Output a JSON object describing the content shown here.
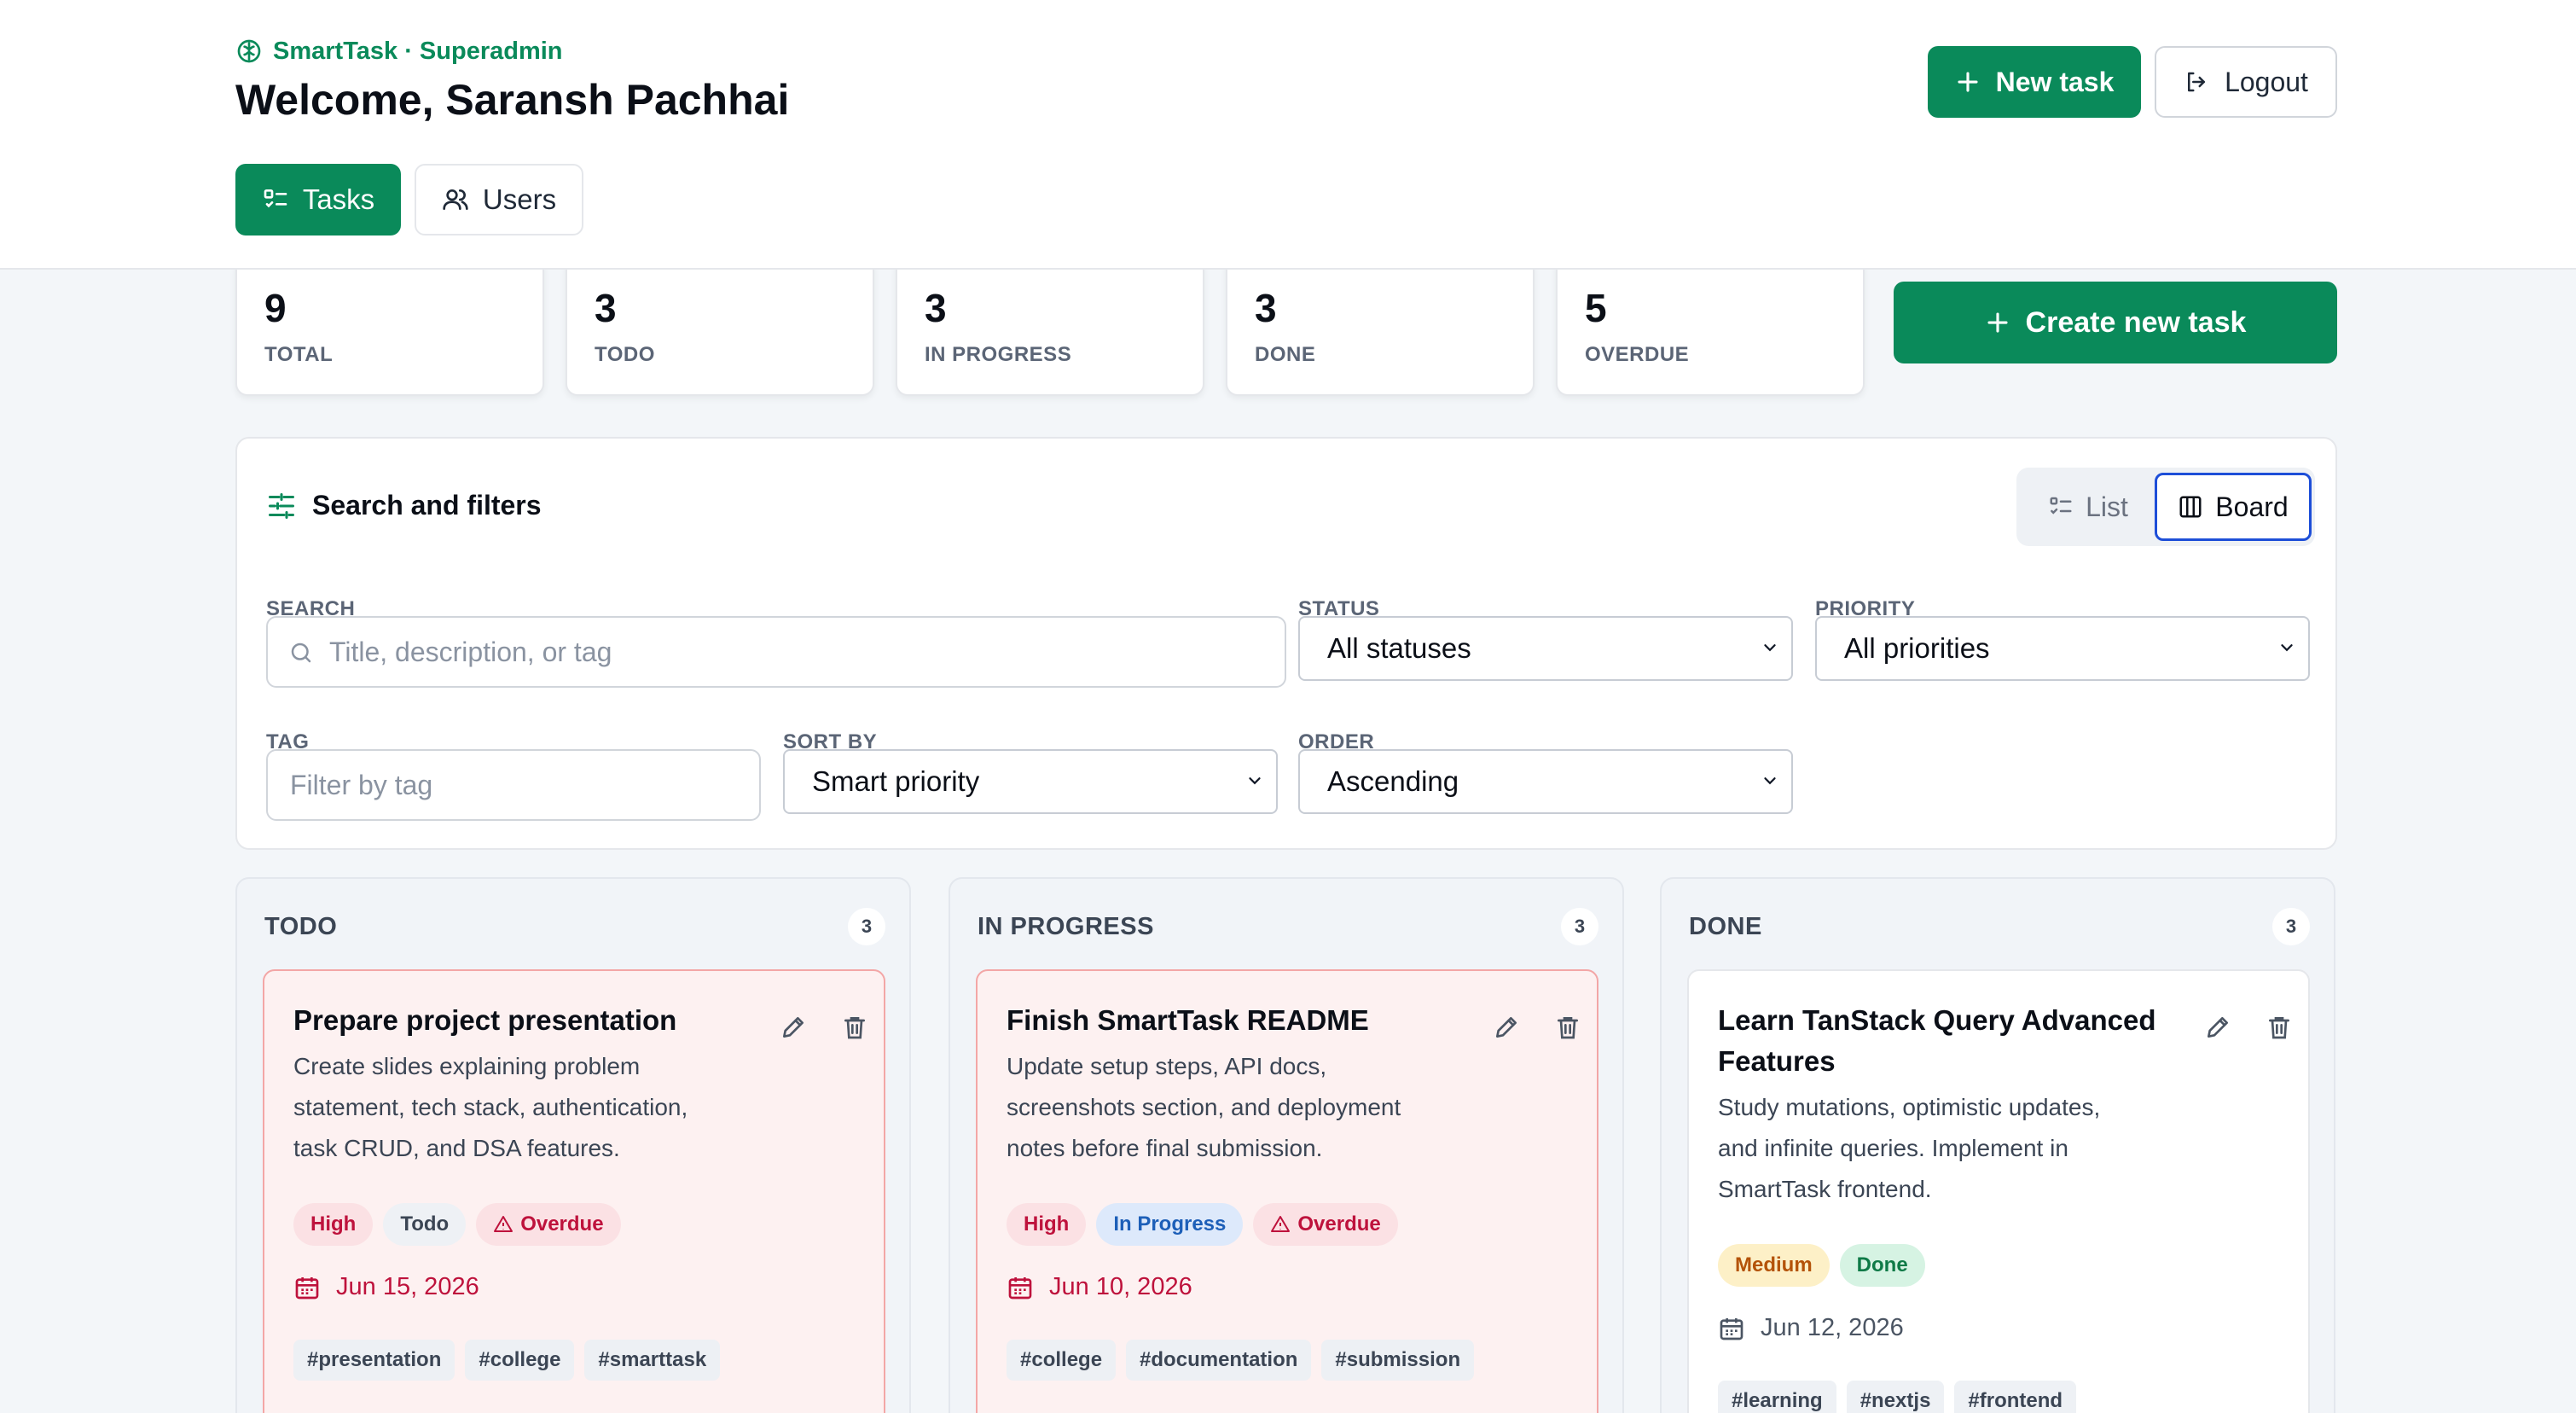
{
  "header": {
    "brand": "SmartTask · Superadmin",
    "welcome": "Welcome, Saransh Pachhai",
    "new_task_label": "New task",
    "logout_label": "Logout"
  },
  "nav": {
    "tabs": [
      {
        "label": "Tasks",
        "active": true
      },
      {
        "label": "Users",
        "active": false
      }
    ]
  },
  "stats": [
    {
      "value": "9",
      "label": "TOTAL"
    },
    {
      "value": "3",
      "label": "TODO"
    },
    {
      "value": "3",
      "label": "IN PROGRESS"
    },
    {
      "value": "3",
      "label": "DONE"
    },
    {
      "value": "5",
      "label": "OVERDUE"
    }
  ],
  "create_button_label": "Create new task",
  "filters": {
    "title": "Search and filters",
    "view_list_label": "List",
    "view_board_label": "Board",
    "active_view": "Board",
    "search_label": "SEARCH",
    "search_placeholder": "Title, description, or tag",
    "status_label": "STATUS",
    "status_value": "All statuses",
    "priority_label": "PRIORITY",
    "priority_value": "All priorities",
    "tag_label": "TAG",
    "tag_placeholder": "Filter by tag",
    "sort_label": "SORT BY",
    "sort_value": "Smart priority",
    "order_label": "ORDER",
    "order_value": "Ascending"
  },
  "board": {
    "columns": [
      {
        "title": "TODO",
        "count": "3",
        "card": {
          "title": "Prepare project presentation",
          "description": "Create slides explaining problem statement, tech stack, authentication, task CRUD, and DSA features.",
          "badges": [
            "High",
            "Todo",
            "Overdue"
          ],
          "due": "Jun 15, 2026",
          "tags": [
            "#presentation",
            "#college",
            "#smarttask"
          ]
        }
      },
      {
        "title": "IN PROGRESS",
        "count": "3",
        "card": {
          "title": "Finish SmartTask README",
          "description": "Update setup steps, API docs, screenshots section, and deployment notes before final submission.",
          "badges": [
            "High",
            "In Progress",
            "Overdue"
          ],
          "due": "Jun 10, 2026",
          "tags": [
            "#college",
            "#documentation",
            "#submission"
          ]
        }
      },
      {
        "title": "DONE",
        "count": "3",
        "card": {
          "title": "Learn TanStack Query Advanced Features",
          "description": "Study mutations, optimistic updates, and infinite queries. Implement in SmartTask frontend.",
          "badges": [
            "Medium",
            "Done"
          ],
          "due": "Jun 12, 2026",
          "tags": [
            "#learning",
            "#nextjs",
            "#frontend"
          ]
        }
      }
    ]
  },
  "colors": {
    "primary": "#0a8a5a",
    "overdue_red": "#be123c",
    "board_active_border": "#1d4ed8"
  },
  "icons": [
    "brain-icon",
    "plus-icon",
    "logout-icon",
    "tasks-icon",
    "users-icon",
    "sliders-icon",
    "list-icon",
    "board-icon",
    "search-icon",
    "chevron-down-icon",
    "pencil-icon",
    "trash-icon",
    "alert-triangle-icon",
    "calendar-icon"
  ]
}
